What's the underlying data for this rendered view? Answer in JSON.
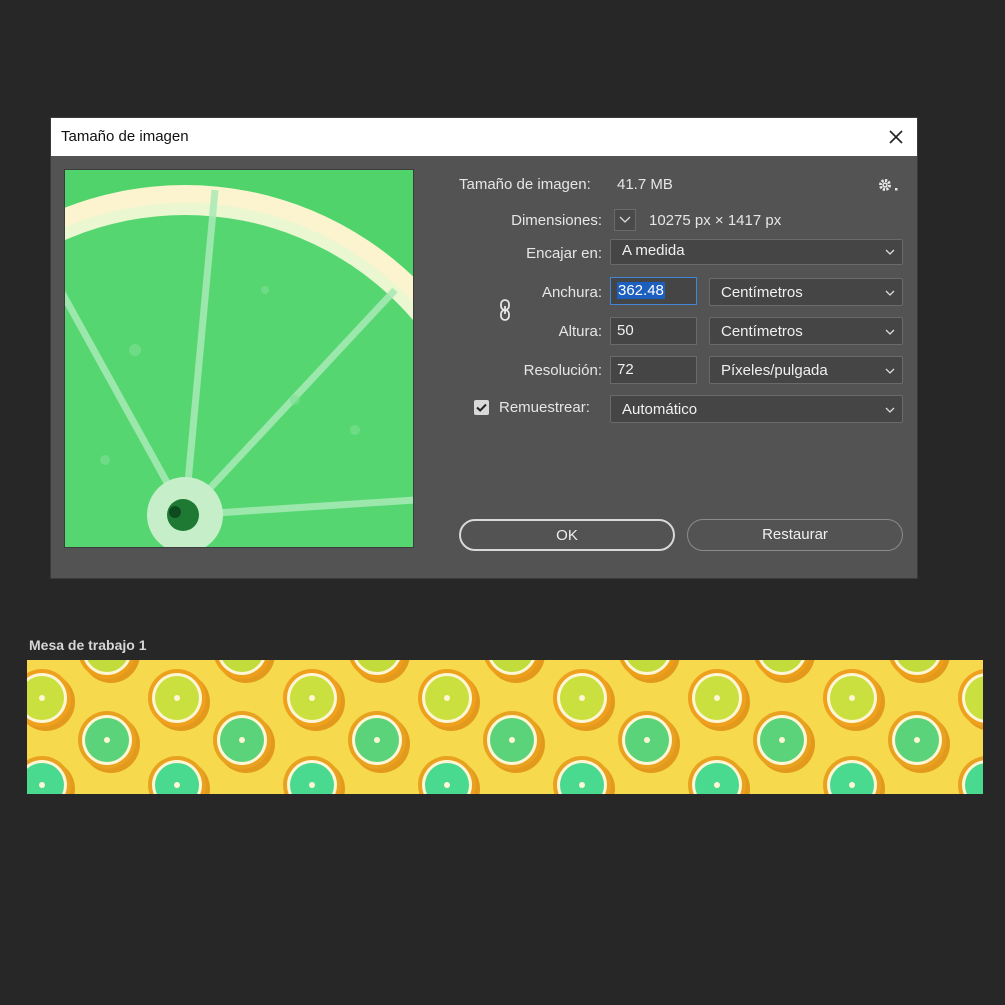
{
  "dialog": {
    "title": "Tamaño de imagen",
    "image_size_label": "Tamaño de imagen:",
    "image_size_value": "41.7 MB",
    "dimensions_label": "Dimensiones:",
    "dimensions_value": "10275 px × 1417 px",
    "fit_label": "Encajar en:",
    "fit_value": "A medida",
    "width_label": "Anchura:",
    "width_value": "362.48",
    "width_unit": "Centímetros",
    "height_label": "Altura:",
    "height_value": "50",
    "height_unit": "Centímetros",
    "resolution_label": "Resolución:",
    "resolution_value": "72",
    "resolution_unit": "Píxeles/pulgada",
    "resample_label": "Remuestrear:",
    "resample_checked": true,
    "resample_value": "Automático",
    "ok_label": "OK",
    "reset_label": "Restaurar"
  },
  "artboard": {
    "title": "Mesa de trabajo 1"
  },
  "colors": {
    "background": "#272727",
    "dialog": "#535353",
    "lime": "#4fd36a",
    "lemon": "#f6d94d"
  },
  "icons": {
    "close": "close-icon",
    "settings": "gear-icon",
    "dropdown": "chevron-down-icon",
    "link": "chain-link-icon",
    "check": "check-icon"
  }
}
